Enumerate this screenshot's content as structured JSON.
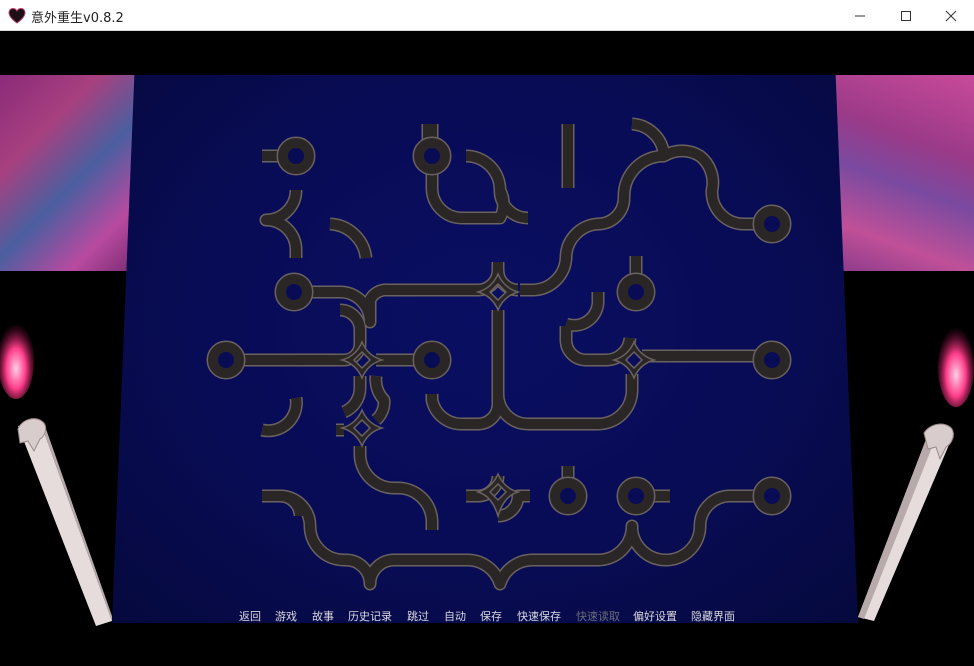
{
  "window": {
    "title": "意外重生v0.8.2",
    "icon": "heart-icon",
    "controls": [
      "minimize-icon",
      "maximize-icon",
      "close-icon"
    ]
  },
  "colors": {
    "panel": "#080c55",
    "pipe": "#2a2626",
    "pipe_edge": "#6a6260",
    "menu_text": "#d8d8e0",
    "menu_disabled": "#6a6a78"
  },
  "quick_menu": {
    "items": [
      {
        "label": "返回",
        "enabled": true
      },
      {
        "label": "游戏",
        "enabled": true
      },
      {
        "label": "故事",
        "enabled": true
      },
      {
        "label": "历史记录",
        "enabled": true
      },
      {
        "label": "跳过",
        "enabled": true
      },
      {
        "label": "自动",
        "enabled": true
      },
      {
        "label": "保存",
        "enabled": true
      },
      {
        "label": "快速保存",
        "enabled": true
      },
      {
        "label": "快速读取",
        "enabled": false
      },
      {
        "label": "偏好设置",
        "enabled": true
      },
      {
        "label": "隐藏界面",
        "enabled": true
      }
    ]
  }
}
